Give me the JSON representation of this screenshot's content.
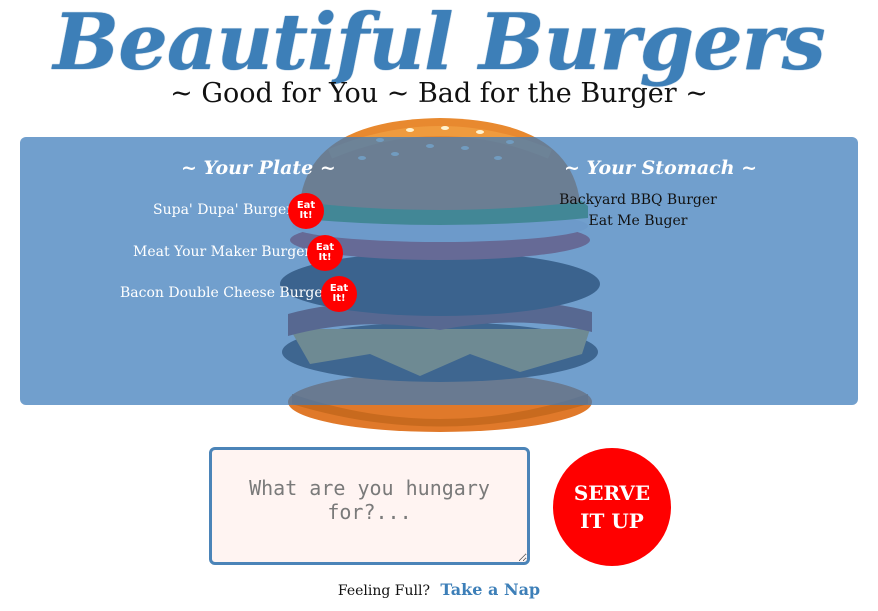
{
  "header": {
    "title": "Beautiful Burgers",
    "subtitle": "~ Good for You ~ Bad for the Burger ~"
  },
  "plate": {
    "heading": "~ Your Plate ~",
    "items": [
      {
        "name": "Supa' Dupa' Burger",
        "button": "Eat It!"
      },
      {
        "name": "Meat Your Maker Burger",
        "button": "Eat It!"
      },
      {
        "name": "Bacon Double Cheese Burger",
        "button": "Eat It!"
      }
    ]
  },
  "stomach": {
    "heading": "~ Your Stomach ~",
    "items": [
      "Backyard BBQ Burger",
      "Eat Me Buger"
    ]
  },
  "order": {
    "placeholder": "What are you hungary for?...",
    "value": "",
    "submit_label": "SERVE IT UP"
  },
  "footer": {
    "prompt": "Feeling Full?",
    "link": "Take a Nap"
  },
  "colors": {
    "brand_blue": "#3d7fb8",
    "button_red": "#ff0000",
    "panel_blue": "#3a7aba"
  }
}
